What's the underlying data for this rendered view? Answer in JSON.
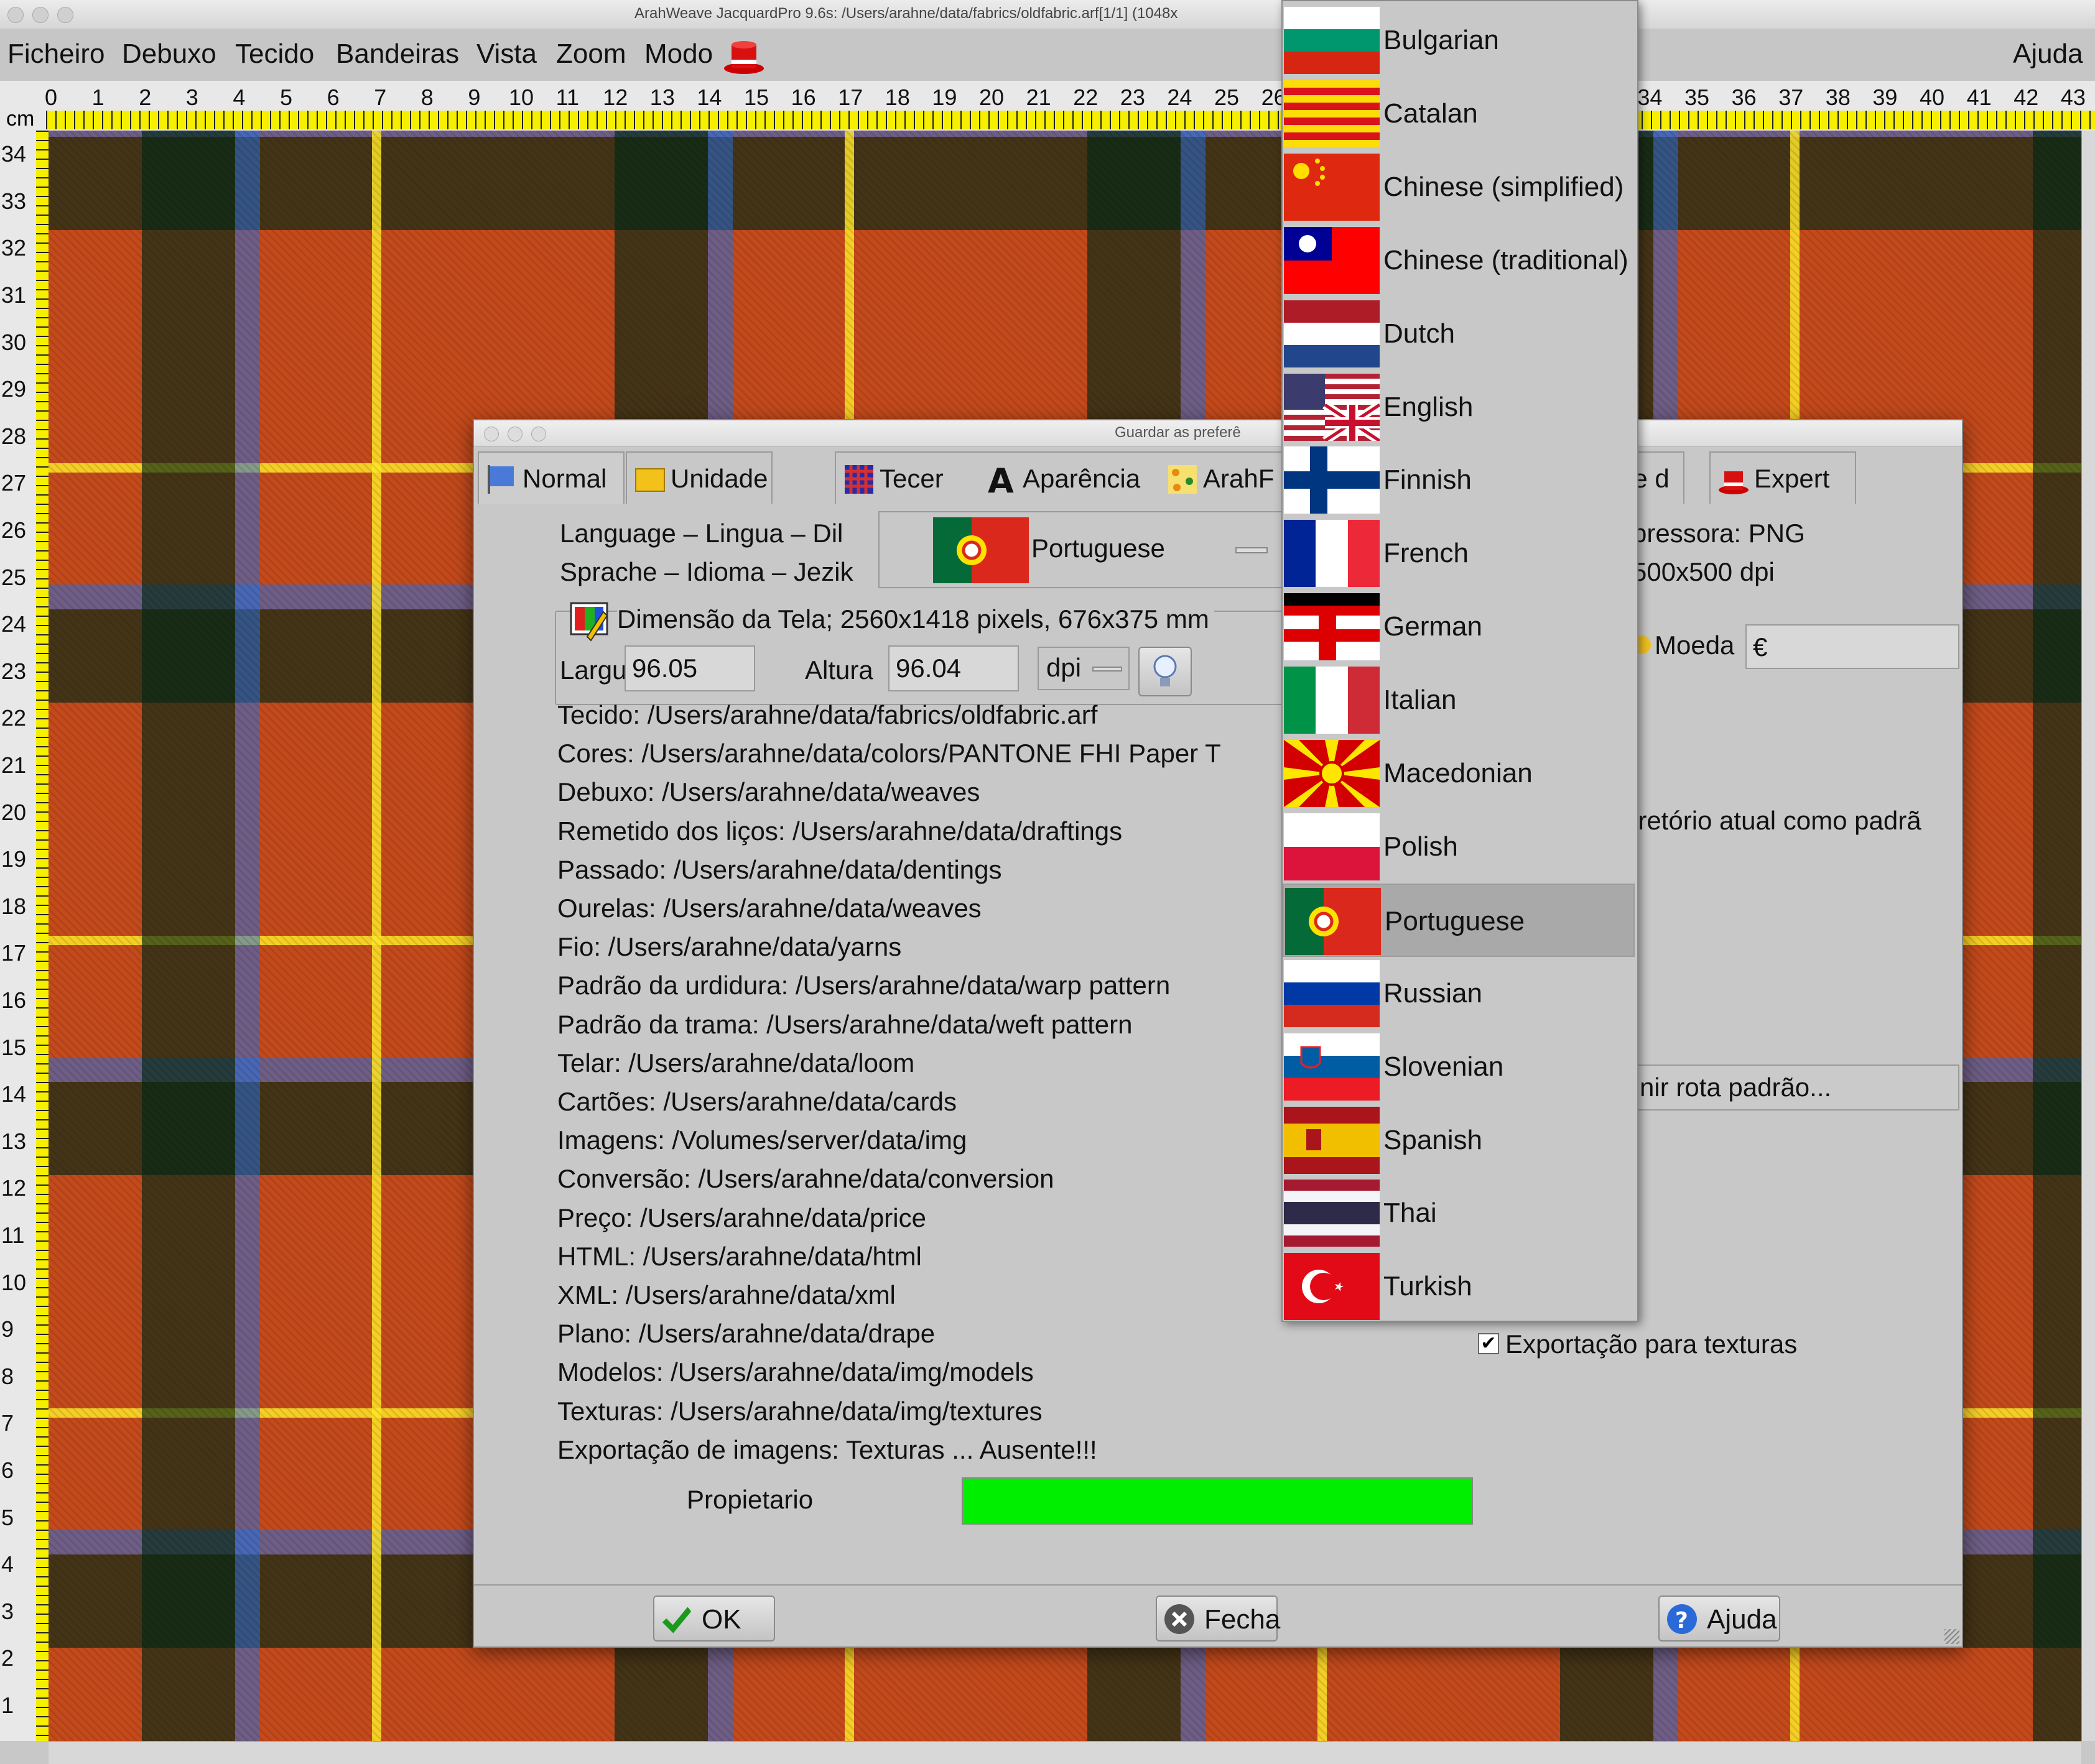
{
  "window": {
    "title": "ArahWeave JacquardPro 9.6s: /Users/arahne/data/fabrics/oldfabric.arf[1/1] (1048x"
  },
  "menubar": {
    "items": [
      "Ficheiro",
      "Debuxo",
      "Tecido",
      "Bandeiras",
      "Vista",
      "Zoom",
      "Modo"
    ],
    "help": "Ajuda"
  },
  "ruler": {
    "unit": "cm",
    "top_ticks": [
      "0",
      "1",
      "2",
      "3",
      "4",
      "5",
      "6",
      "7",
      "8",
      "9",
      "10",
      "11",
      "12",
      "13",
      "14",
      "15",
      "16",
      "17",
      "18",
      "19",
      "20",
      "21",
      "22",
      "23",
      "24",
      "25",
      "26",
      "34",
      "35",
      "36",
      "37",
      "38",
      "39",
      "40",
      "41",
      "42",
      "43"
    ],
    "left_ticks": [
      "34",
      "33",
      "32",
      "31",
      "30",
      "29",
      "28",
      "27",
      "26",
      "25",
      "24",
      "23",
      "22",
      "21",
      "20",
      "19",
      "18",
      "17",
      "16",
      "15",
      "14",
      "13",
      "12",
      "11",
      "10",
      "9",
      "8",
      "7",
      "6",
      "5",
      "4",
      "3",
      "2",
      "1"
    ]
  },
  "dialog": {
    "title": "Guardar as preferê",
    "tabs": [
      "Normal",
      "Unidade",
      "Tecer",
      "Aparência",
      "ArahF",
      "de d",
      "Expert"
    ],
    "language_label_1": "Language – Lingua – Dil",
    "language_label_2": "Sprache – Idioma – Jezik",
    "language_selected": "Portuguese",
    "printer_line_1": "pressora: PNG",
    "printer_line_2": "500x500 dpi",
    "currency_label": "Moeda",
    "currency_value": "€",
    "screen_dim": "Dimensão da Tela; 2560x1418 pixels, 676x375 mm",
    "width_label": "Largura",
    "width_value": "96.05",
    "height_label": "Altura",
    "height_value": "96.04",
    "dpi_unit": "dpi",
    "dir_default_text": "iretório atual como padrã",
    "default_route_button": "nir rota padrão...",
    "paths": [
      "Tecido: /Users/arahne/data/fabrics/oldfabric.arf",
      "Cores: /Users/arahne/data/colors/PANTONE FHI Paper T",
      "Debuxo: /Users/arahne/data/weaves",
      "Remetido dos liços: /Users/arahne/data/draftings",
      "Passado: /Users/arahne/data/dentings",
      "Ourelas: /Users/arahne/data/weaves",
      "Fio: /Users/arahne/data/yarns",
      "Padrão da urdidura: /Users/arahne/data/warp pattern",
      "Padrão da trama: /Users/arahne/data/weft pattern",
      "Telar: /Users/arahne/data/loom",
      "Cartões: /Users/arahne/data/cards",
      "Imagens: /Volumes/server/data/img",
      "Conversão: /Users/arahne/data/conversion",
      "Preço: /Users/arahne/data/price",
      "HTML: /Users/arahne/data/html",
      "XML: /Users/arahne/data/xml",
      "Plano: /Users/arahne/data/drape",
      "Modelos: /Users/arahne/data/img/models",
      "Texturas: /Users/arahne/data/img/textures",
      "Exportação de imagens: Texturas ... Ausente!!!"
    ],
    "texture_export_checkbox": "Exportação para texturas",
    "texture_export_checked": true,
    "owner_label": "Propietario",
    "owner_color": "#00ee00",
    "ok_button": "OK",
    "close_button": "Fecha",
    "help_button": "Ajuda"
  },
  "language_dropdown": {
    "items": [
      "Bulgarian",
      "Catalan",
      "Chinese (simplified)",
      "Chinese (traditional)",
      "Dutch",
      "English",
      "Finnish",
      "French",
      "German",
      "Italian",
      "Macedonian",
      "Polish",
      "Portuguese",
      "Russian",
      "Slovenian",
      "Spanish",
      "Thai",
      "Turkish"
    ],
    "selected": "Portuguese"
  },
  "colors": {
    "fabric_base": "#c44a1c",
    "ruler_yellow": "#f6f000",
    "selection": "#a9a9a9"
  }
}
